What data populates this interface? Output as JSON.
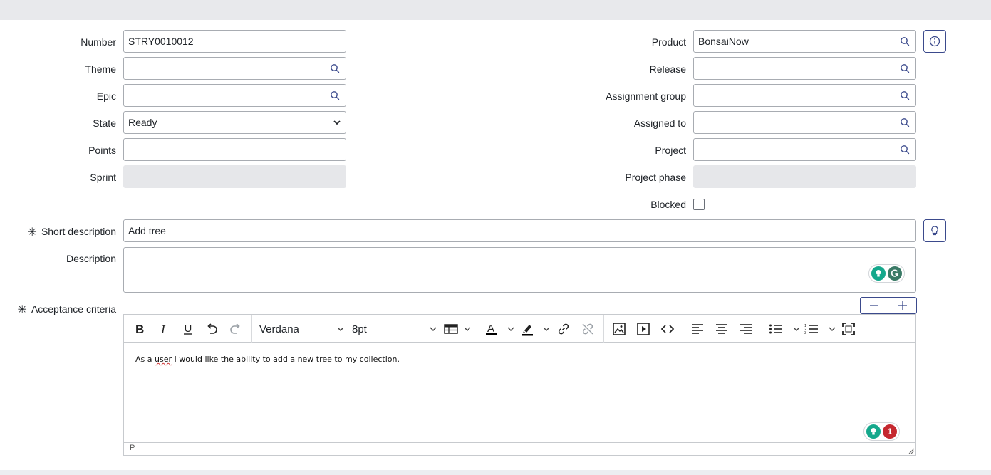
{
  "form": {
    "number_label": "Number",
    "number_value": "STRY0010012",
    "theme_label": "Theme",
    "epic_label": "Epic",
    "state_label": "State",
    "state_value": "Ready",
    "points_label": "Points",
    "sprint_label": "Sprint",
    "product_label": "Product",
    "product_value": "BonsaiNow",
    "release_label": "Release",
    "assignment_group_label": "Assignment group",
    "assigned_to_label": "Assigned to",
    "project_label": "Project",
    "project_phase_label": "Project phase",
    "blocked_label": "Blocked",
    "short_description_label": "Short description",
    "short_description_value": "Add tree",
    "description_label": "Description",
    "acceptance_label": "Acceptance criteria",
    "required_marker": "✳"
  },
  "editor": {
    "font_family": "Verdana",
    "font_size": "8pt",
    "content_before": "As a ",
    "content_misspelled": "user",
    "content_after": " I would like the ability to add a new tree to my collection.",
    "status_path": "P",
    "issue_count": "1"
  },
  "colors": {
    "accent": "#3b4a8c",
    "grammarly_green": "#15a88c",
    "grammarly_dark": "#3a7a66",
    "alert_red": "#c5282f"
  }
}
